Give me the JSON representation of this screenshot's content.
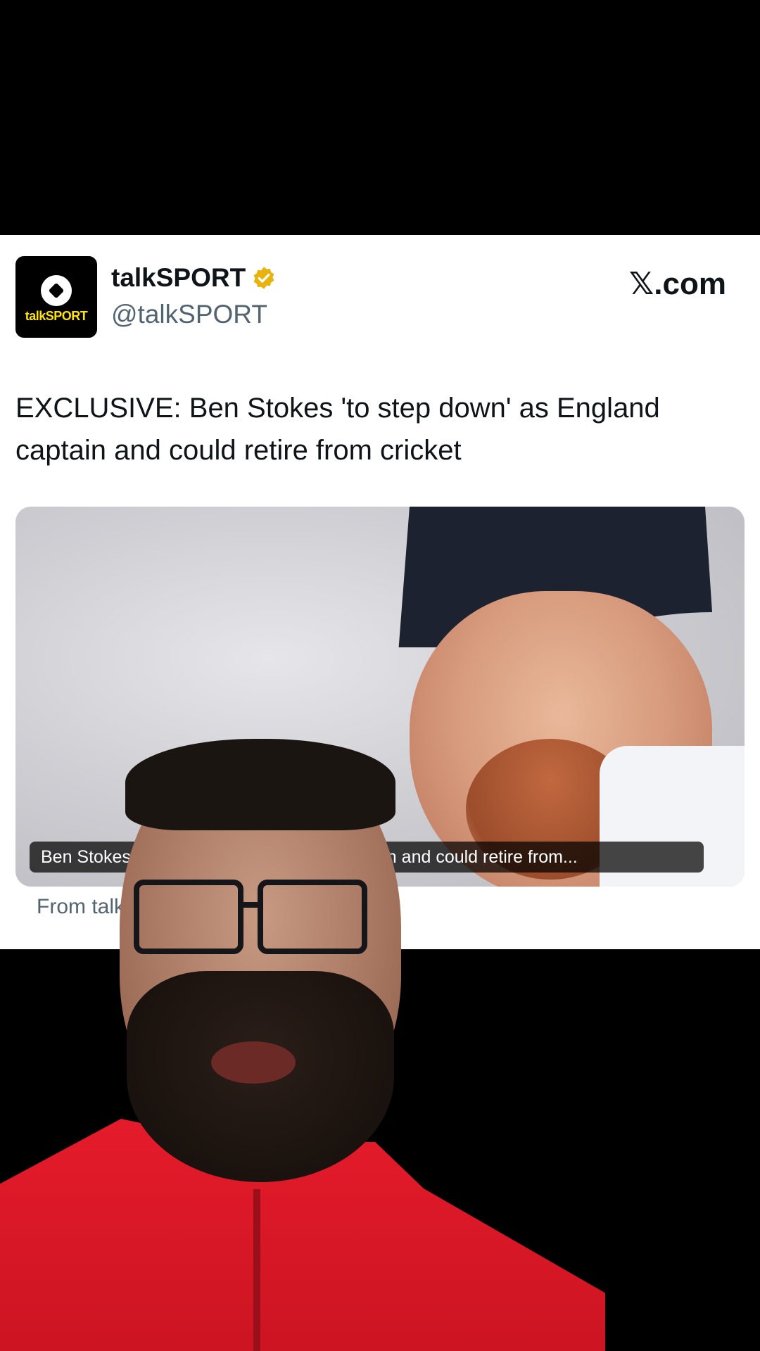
{
  "tweet": {
    "avatar_brand": "talkSPORT",
    "display_name": "talkSPORT",
    "handle": "@talkSPORT",
    "site": "𝕏.com",
    "text": "EXCLUSIVE: Ben Stokes 'to step down' as England captain and could retire from cricket",
    "media_headline": "Ben Stokes 'to step down' as England captain and could retire from...",
    "source": "From talksport.com"
  },
  "colors": {
    "background": "#000000",
    "card": "#ffffff",
    "brand_yellow": "#ffe400",
    "verified_gold": "#e8b30d",
    "presenter_jacket": "#e51b2b"
  },
  "icons": {
    "verified": "verified-badge-icon",
    "logo": "talksport-logo-icon"
  }
}
